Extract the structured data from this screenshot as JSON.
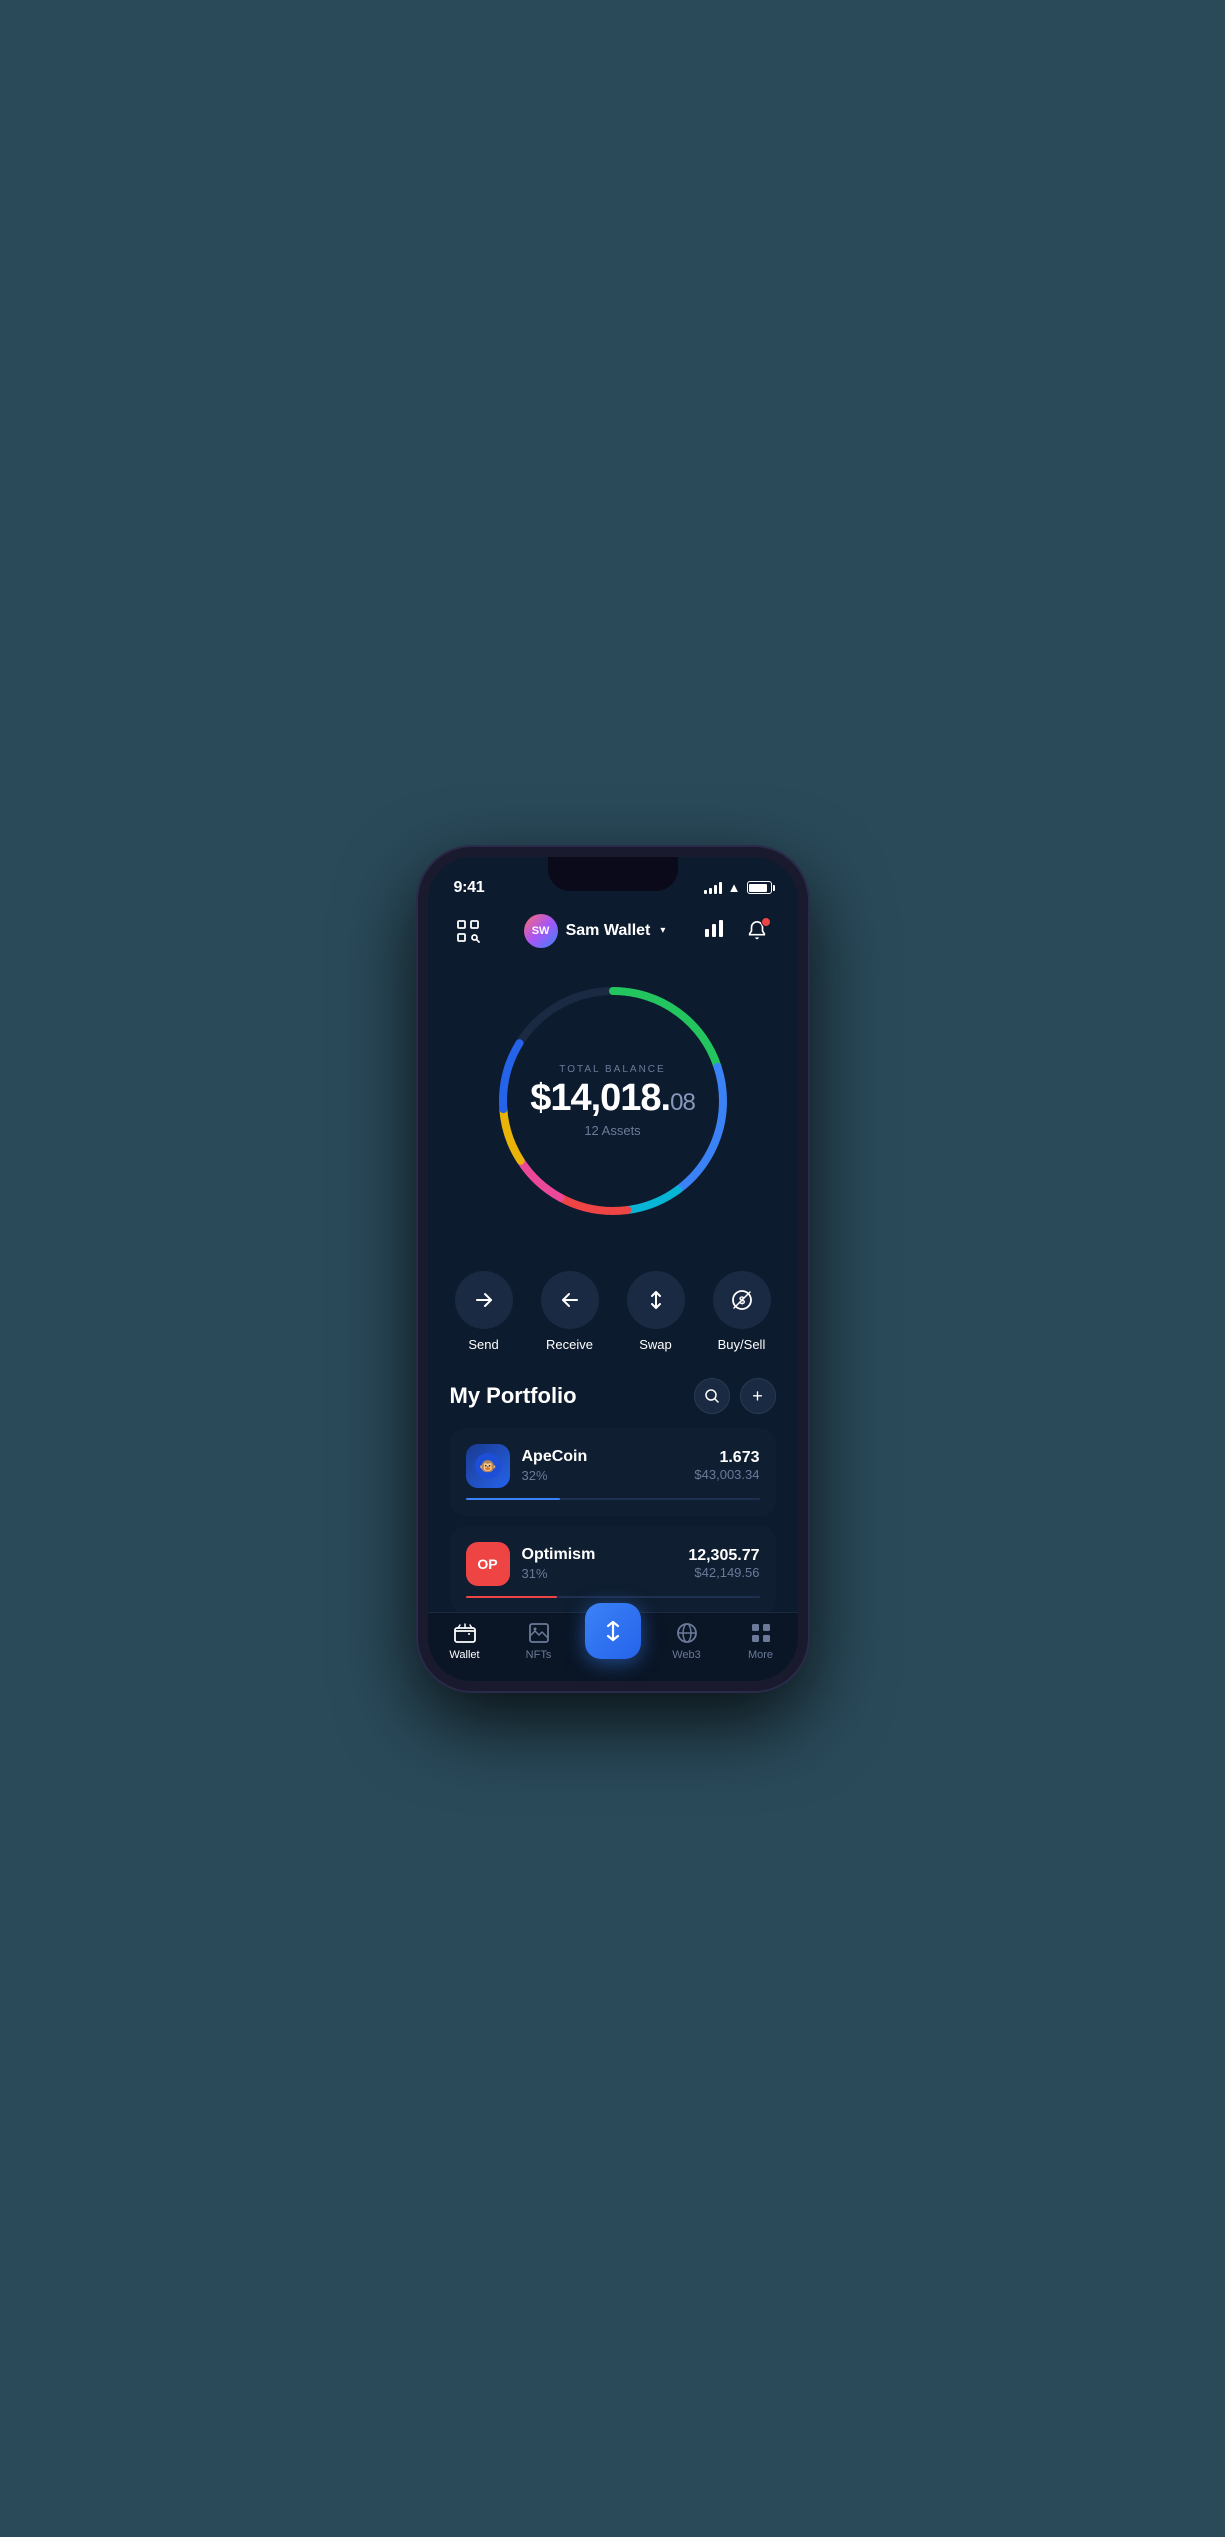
{
  "statusBar": {
    "time": "9:41"
  },
  "header": {
    "scannerLabel": "⊡",
    "avatarInitials": "SW",
    "walletName": "Sam Wallet",
    "chartIconLabel": "📊",
    "bellIconLabel": "🔔"
  },
  "balance": {
    "label": "TOTAL BALANCE",
    "whole": "$14,018.",
    "cents": "08",
    "assets": "12 Assets"
  },
  "actions": [
    {
      "icon": "→",
      "label": "Send"
    },
    {
      "icon": "←",
      "label": "Receive"
    },
    {
      "icon": "↕",
      "label": "Swap"
    },
    {
      "icon": "⊙",
      "label": "Buy/Sell"
    }
  ],
  "portfolio": {
    "title": "My Portfolio",
    "searchLabel": "🔍",
    "addLabel": "+"
  },
  "assets": [
    {
      "name": "ApeCoin",
      "pct": "32%",
      "amount": "1.673",
      "usd": "$43,003.34",
      "barColor": "#3b82f6",
      "barWidth": "32",
      "logoType": "ape"
    },
    {
      "name": "Optimism",
      "pct": "31%",
      "amount": "12,305.77",
      "usd": "$42,149.56",
      "barColor": "#ef4444",
      "barWidth": "31",
      "logoType": "op"
    }
  ],
  "bottomNav": [
    {
      "icon": "👛",
      "label": "Wallet",
      "active": true
    },
    {
      "icon": "🖼",
      "label": "NFTs",
      "active": false
    },
    {
      "icon": "↕↕",
      "label": "",
      "active": false,
      "isFab": true
    },
    {
      "icon": "🌐",
      "label": "Web3",
      "active": false
    },
    {
      "icon": "⊞",
      "label": "More",
      "active": false
    }
  ]
}
